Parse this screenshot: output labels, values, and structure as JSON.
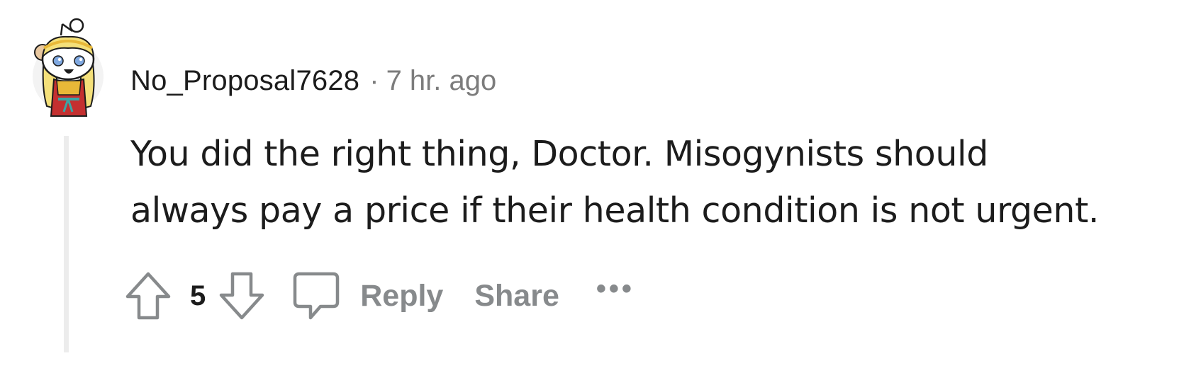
{
  "comment": {
    "username": "No_Proposal7628",
    "separator": "·",
    "timestamp": "7 hr. ago",
    "body_lines": [
      "You did the right thing, Doctor. Misogynists should",
      "always pay a price if their health condition is not urgent."
    ],
    "avatar_icon": "snoo-avatar-icon",
    "actions": {
      "upvote_icon": "arrow-up-icon",
      "vote_count": "5",
      "downvote_icon": "arrow-down-icon",
      "reply_icon": "speech-bubble-icon",
      "reply_label": "Reply",
      "share_label": "Share",
      "more_label": "•••"
    }
  },
  "colors": {
    "text_primary": "#1c1c1c",
    "text_secondary": "#7c7c7c",
    "action_gray": "#878a8c",
    "thread_line": "#ececec"
  }
}
